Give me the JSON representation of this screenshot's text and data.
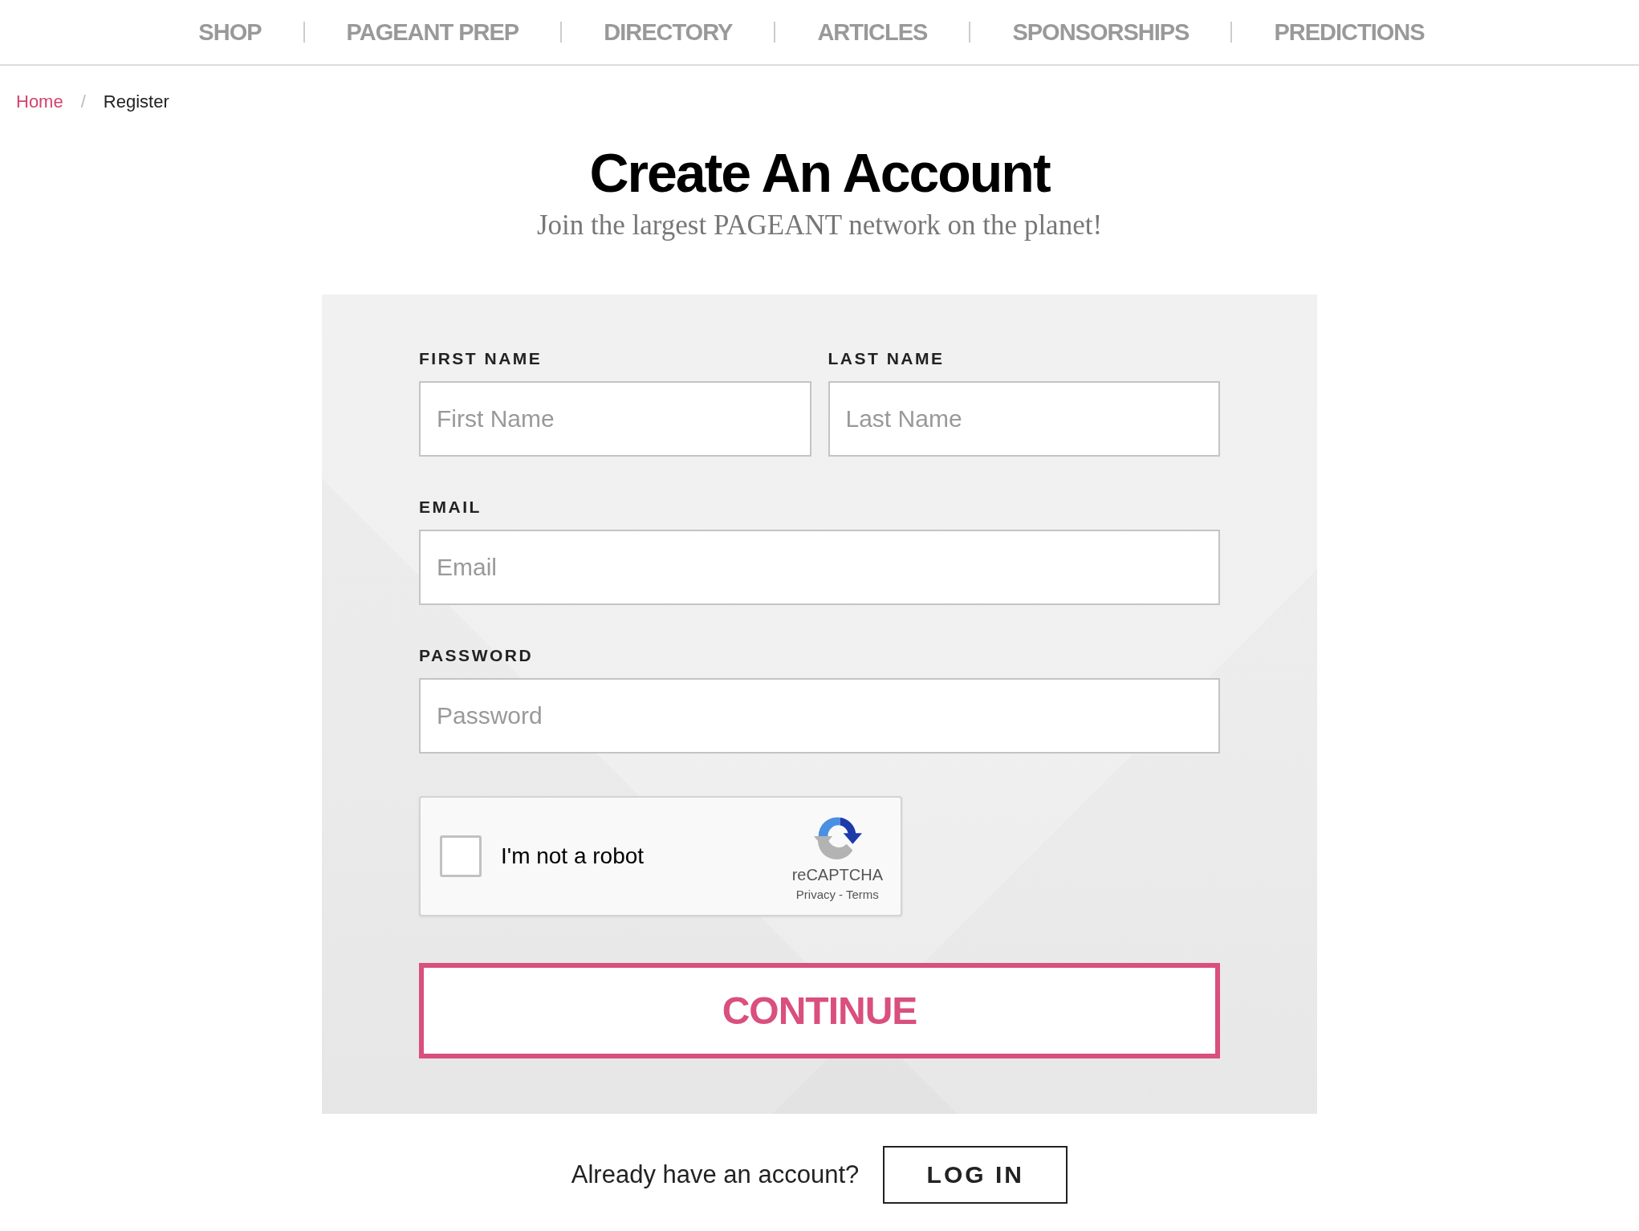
{
  "nav": [
    {
      "label": "SHOP"
    },
    {
      "label": "PAGEANT PREP"
    },
    {
      "label": "DIRECTORY"
    },
    {
      "label": "ARTICLES"
    },
    {
      "label": "SPONSORSHIPS"
    },
    {
      "label": "PREDICTIONS"
    }
  ],
  "breadcrumb": {
    "items": [
      {
        "label": "Home",
        "kind": "link"
      },
      {
        "label": "Register",
        "kind": "current"
      }
    ],
    "separator": "/"
  },
  "title": "Create An Account",
  "subtitle": "Join the largest PAGEANT network on the planet!",
  "form": {
    "rows": [
      [
        {
          "label": "FIRST NAME",
          "placeholder": "First Name"
        },
        {
          "label": "LAST NAME",
          "placeholder": "Last Name"
        }
      ],
      [
        {
          "label": "EMAIL",
          "placeholder": "Email"
        }
      ],
      [
        {
          "label": "PASSWORD",
          "placeholder": "Password"
        }
      ]
    ],
    "captcha": {
      "label": "I'm not a robot",
      "checked": false,
      "brand": "reCAPTCHA",
      "privacy": "Privacy",
      "separator": "-",
      "terms": "Terms"
    },
    "submit": "CONTINUE"
  },
  "login": {
    "prompt": "Already have an account?",
    "button": "LOG IN"
  }
}
